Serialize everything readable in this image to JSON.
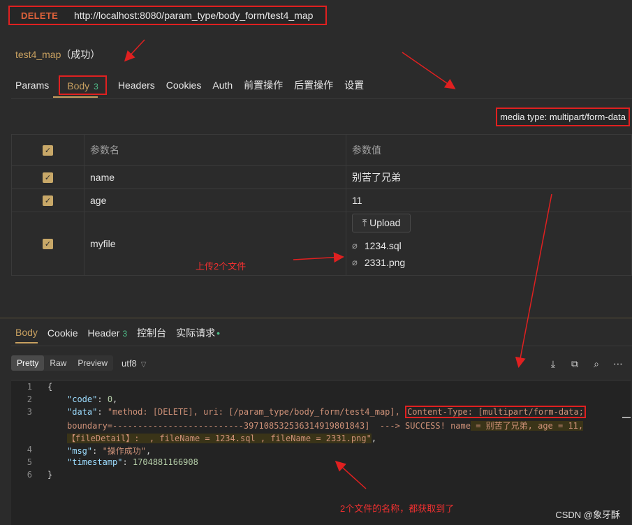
{
  "request": {
    "method": "DELETE",
    "url": "http://localhost:8080/param_type/body_form/test4_map",
    "name": "test4_map",
    "status": "（成功）"
  },
  "request_tabs": [
    {
      "label": "Params"
    },
    {
      "label": "Body",
      "count": "3"
    },
    {
      "label": "Headers"
    },
    {
      "label": "Cookies"
    },
    {
      "label": "Auth"
    },
    {
      "label": "前置操作"
    },
    {
      "label": "后置操作"
    },
    {
      "label": "设置"
    }
  ],
  "media_type": "media type: multipart/form-data",
  "params": {
    "headers": {
      "name": "参数名",
      "value": "参数值"
    },
    "rows": [
      {
        "name": "name",
        "value": "别苦了兄弟"
      },
      {
        "name": "age",
        "value": "11"
      },
      {
        "name": "myfile",
        "upload_label": "Upload",
        "files": [
          "1234.sql",
          "2331.png"
        ]
      }
    ]
  },
  "annotations": {
    "upload_note": "上传2个文件",
    "files_note": "2个文件的名称，都获取到了"
  },
  "response_tabs": [
    {
      "label": "Body"
    },
    {
      "label": "Cookie"
    },
    {
      "label": "Header",
      "count": "3"
    },
    {
      "label": "控制台"
    },
    {
      "label": "实际请求"
    }
  ],
  "view_modes": [
    "Pretty",
    "Raw",
    "Preview"
  ],
  "encoding": "utf8",
  "icons": {
    "upload": "upload-icon",
    "attachment": "paperclip-icon",
    "checkbox": "checkmark-icon",
    "save": "download-icon",
    "copy": "copy-icon",
    "search": "search-icon",
    "more": "more-icon"
  },
  "code_lines": {
    "l1": {
      "no": "1",
      "text": "{"
    },
    "l2": {
      "no": "2",
      "key": "\"code\"",
      "sep": ": ",
      "val": "0",
      "end": ","
    },
    "l3": {
      "no": "3",
      "key": "\"data\"",
      "sep": ": ",
      "part1": "\"method: [DELETE], uri: [/param_type/body_form/test4_map], ",
      "part2": "Content-Type: [multipart/form-data;"
    },
    "l3b": {
      "part1": "boundary=--------------------------397108532536314919801843]",
      "part2": "  ---> SUCCESS! name",
      "part3": " = 别苦了兄弟, age = 11,"
    },
    "l3c": {
      "part1": "【fileDetail】: ",
      "part2": " , fileName = 1234.sql , fileName = 2331.png\"",
      "end": ","
    },
    "l4": {
      "no": "4",
      "key": "\"msg\"",
      "sep": ": ",
      "val": "\"操作成功\"",
      "end": ","
    },
    "l5": {
      "no": "5",
      "key": "\"timestamp\"",
      "sep": ": ",
      "val": "1704881166908"
    },
    "l6": {
      "no": "6",
      "text": "}"
    }
  },
  "watermark": "CSDN @象牙酥",
  "colors": {
    "accent": "#c8a060",
    "method_delete": "#e0623a",
    "annotation_red": "#e02020",
    "count_green": "#4fbf8a",
    "background": "#2b2b2b"
  }
}
